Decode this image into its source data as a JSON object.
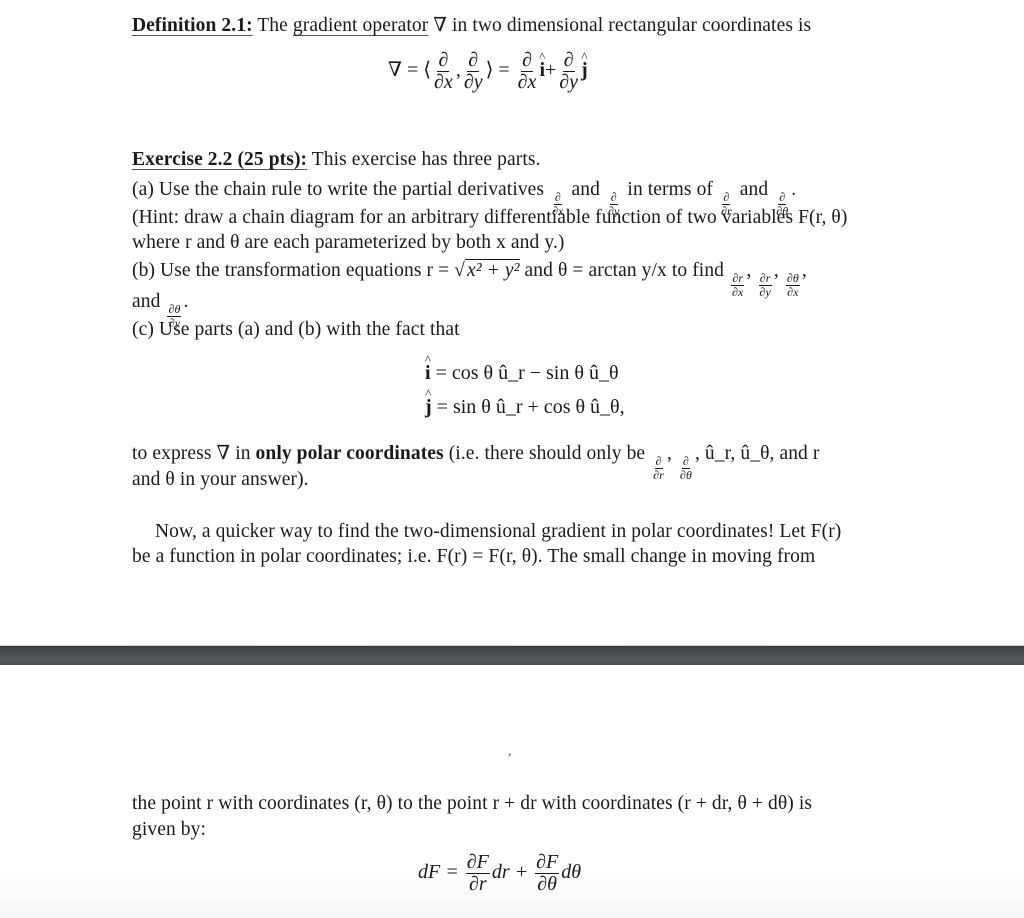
{
  "document": {
    "definition": {
      "label": "Definition 2.1:",
      "text_before": " The ",
      "term": "gradient operator",
      "text_after": " ∇ in two dimensional rectangular coordinates is",
      "equation": {
        "lhs": "∇ = ⟨",
        "partial": "∂",
        "dx": "∂x",
        "dy": "∂y",
        "comma": ",",
        "close": "⟩ =",
        "i_hat": "i",
        "plus": "+",
        "j_hat": "j"
      }
    },
    "exercise": {
      "label": "Exercise 2.2 (25 pts):",
      "intro": " This exercise has three parts.",
      "part_a": {
        "line1_start": "(a) Use the chain rule to write the partial derivatives ",
        "and1": " and ",
        "in_terms": " in terms of ",
        "and2": " and ",
        "period": ".",
        "line2": "(Hint: draw a chain diagram for an arbitrary differentiable function of two variables F(r, θ)",
        "line3": "where r and θ are each parameterized by both x and y.)"
      },
      "part_b": {
        "line1_start": "(b) Use the transformation equations r = ",
        "sqrt_content": "x² + y²",
        "line1_mid": " and θ = arctan y/x to find ",
        "fracs": [
          "∂r/∂x",
          "∂r/∂y",
          "∂θ/∂x"
        ],
        "line2_start": "and ",
        "last_frac": "∂θ/∂y",
        "line2_end": "."
      },
      "part_c": {
        "line1": "(c) Use parts (a) and (b) with the fact that",
        "eq_i": "= cos θ û_r − sin θ û_θ",
        "eq_j": "= sin θ û_r + cos θ û_θ,",
        "express_start": "to express ∇ in ",
        "bold": "only polar coordinates",
        "express_mid": " (i.e. there should only be ",
        "express_list": ", û_r, û_θ, and r",
        "line_last": "and θ in your answer)."
      }
    },
    "paragraph": {
      "line1": "Now, a quicker way to find the two-dimensional gradient in polar coordinates! Let F(r)",
      "line2": "be a function in polar coordinates; i.e. F(r) = F(r, θ). The small change in moving from",
      "stray_mark": ",",
      "line3": "the point r with coordinates (r, θ) to the point r + dr with coordinates (r + dr, θ + dθ) is",
      "line4": "given by:",
      "equation": {
        "lhs": "dF =",
        "frac1_num": "∂F",
        "frac1_den": "∂r",
        "mid": "dr +",
        "frac2_num": "∂F",
        "frac2_den": "∂θ",
        "end": "dθ"
      }
    }
  }
}
